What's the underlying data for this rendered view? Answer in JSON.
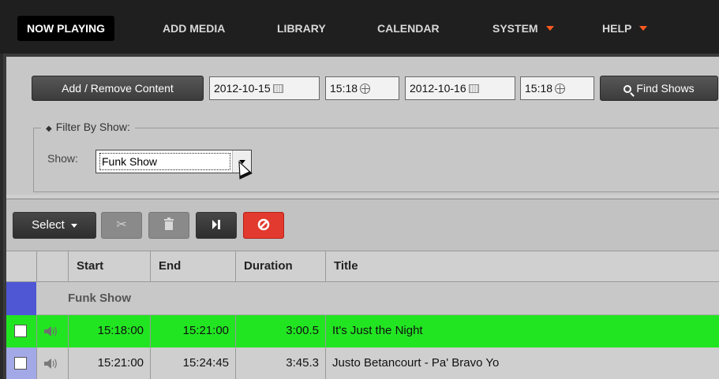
{
  "nav": {
    "items": [
      {
        "label": "NOW PLAYING",
        "active": true
      },
      {
        "label": "ADD MEDIA"
      },
      {
        "label": "LIBRARY"
      },
      {
        "label": "CALENDAR"
      },
      {
        "label": "SYSTEM",
        "dropdown": true
      },
      {
        "label": "HELP",
        "dropdown": true
      }
    ]
  },
  "controls": {
    "add_remove_label": "Add / Remove Content",
    "start_date": "2012-10-15",
    "start_time": "15:18",
    "end_date": "2012-10-16",
    "end_time": "15:18",
    "find_shows_label": "Find Shows"
  },
  "filter": {
    "legend": "Filter By Show:",
    "show_label": "Show:",
    "selected_show": "Funk Show"
  },
  "toolbar": {
    "select_label": "Select"
  },
  "table": {
    "columns": [
      "Start",
      "End",
      "Duration",
      "Title"
    ],
    "group": "Funk Show",
    "rows": [
      {
        "start": "15:18:00",
        "end": "15:21:00",
        "duration": "3:00.5",
        "title": "It's Just the Night",
        "status": "playing"
      },
      {
        "start": "15:21:00",
        "end": "15:24:45",
        "duration": "3:45.3",
        "title": "Justo Betancourt - Pa' Bravo Yo",
        "status": "scheduled"
      }
    ]
  },
  "colors": {
    "playing_row": "#22e522",
    "group_marker": "#4f57d4",
    "remove_button": "#e23a2e",
    "nav_caret": "#ff5a1f"
  }
}
